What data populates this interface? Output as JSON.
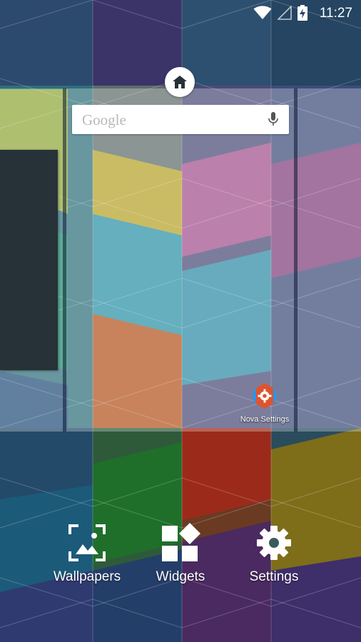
{
  "status_bar": {
    "time": "11:27",
    "icons": [
      "wifi-icon",
      "signal-icon",
      "battery-charging-icon"
    ]
  },
  "home_indicator": {
    "icon": "home-icon"
  },
  "search_widget": {
    "provider": "Google",
    "icon": "mic-icon"
  },
  "desktop_icons": [
    {
      "label": "Nova Settings",
      "icon": "nova-settings-icon"
    }
  ],
  "bottom_actions": [
    {
      "label": "Wallpapers",
      "icon": "wallpaper-icon"
    },
    {
      "label": "Widgets",
      "icon": "widgets-icon"
    },
    {
      "label": "Settings",
      "icon": "gear-icon"
    }
  ],
  "colors": {
    "card_dark": "#263238",
    "nova_red": "#e0532f",
    "nova_blue": "#2196f3"
  }
}
